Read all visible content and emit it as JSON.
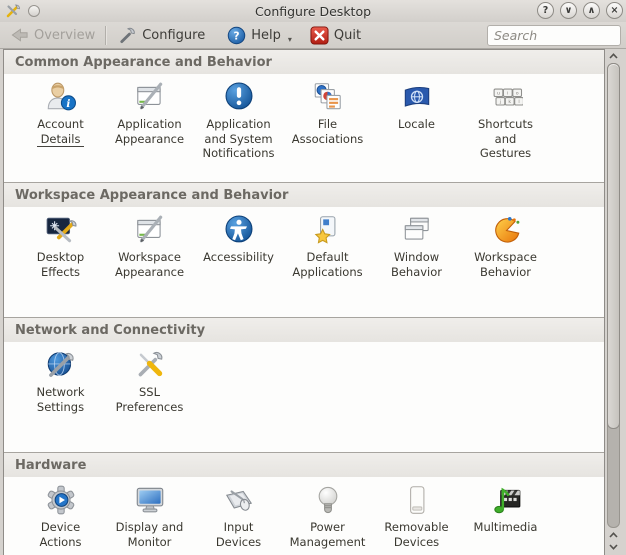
{
  "window": {
    "title": "Configure Desktop",
    "buttons": [
      {
        "name": "help",
        "glyph": "?"
      },
      {
        "name": "minimize",
        "glyph": "∨"
      },
      {
        "name": "maximize",
        "glyph": "∧"
      },
      {
        "name": "close",
        "glyph": "×"
      }
    ]
  },
  "toolbar": {
    "overview_label": "Overview",
    "configure_label": "Configure",
    "help_label": "Help",
    "quit_label": "Quit",
    "search_placeholder": "Search"
  },
  "sections": [
    {
      "title": "Common Appearance and Behavior",
      "items": [
        {
          "id": "account-details",
          "label": "Account\nDetails",
          "underlined": true
        },
        {
          "id": "application-appearance",
          "label": "Application\nAppearance"
        },
        {
          "id": "application-system-notifications",
          "label": "Application\nand System\nNotifications"
        },
        {
          "id": "file-associations",
          "label": "File\nAssociations"
        },
        {
          "id": "locale",
          "label": "Locale"
        },
        {
          "id": "shortcuts-gestures",
          "label": "Shortcuts\nand\nGestures"
        }
      ]
    },
    {
      "title": "Workspace Appearance and Behavior",
      "items": [
        {
          "id": "desktop-effects",
          "label": "Desktop\nEffects"
        },
        {
          "id": "workspace-appearance",
          "label": "Workspace\nAppearance"
        },
        {
          "id": "accessibility",
          "label": "Accessibility"
        },
        {
          "id": "default-applications",
          "label": "Default\nApplications"
        },
        {
          "id": "window-behavior",
          "label": "Window\nBehavior"
        },
        {
          "id": "workspace-behavior",
          "label": "Workspace\nBehavior"
        }
      ]
    },
    {
      "title": "Network and Connectivity",
      "items": [
        {
          "id": "network-settings",
          "label": "Network\nSettings"
        },
        {
          "id": "ssl-preferences",
          "label": "SSL\nPreferences"
        }
      ]
    },
    {
      "title": "Hardware",
      "items": [
        {
          "id": "device-actions",
          "label": "Device\nActions"
        },
        {
          "id": "display-monitor",
          "label": "Display and\nMonitor"
        },
        {
          "id": "input-devices",
          "label": "Input\nDevices"
        },
        {
          "id": "power-management",
          "label": "Power\nManagement"
        },
        {
          "id": "removable-devices",
          "label": "Removable\nDevices"
        },
        {
          "id": "multimedia",
          "label": "Multimedia"
        }
      ]
    }
  ],
  "colors": {
    "window_bg": "#d5d2ce",
    "content_bg": "#fdfdfc",
    "section_header_bg": "#eceae6",
    "accent_blue": "#1b5ca3",
    "quit_red": "#b01d12"
  }
}
